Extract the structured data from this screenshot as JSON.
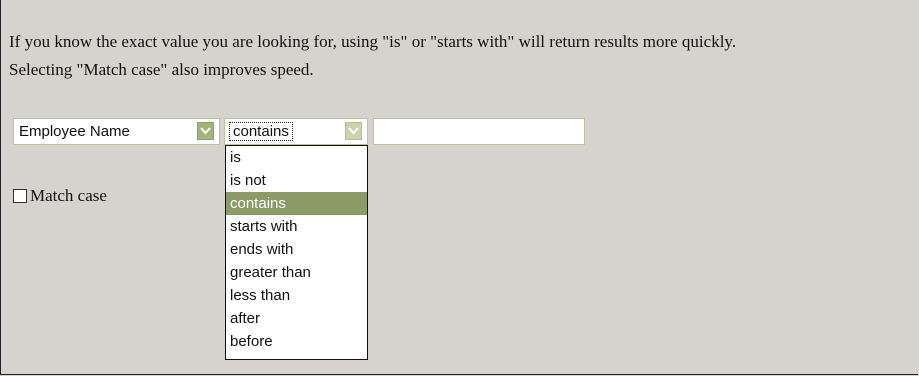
{
  "intro": {
    "line1": "If you know the exact value you are looking for, using \"is\" or \"starts with\" will return results more quickly.",
    "line2": "Selecting \"Match case\" also improves speed."
  },
  "filter": {
    "field_select": {
      "value": "Employee Name",
      "arrow_icon": "chevron-down-icon"
    },
    "operator_select": {
      "value": "contains",
      "arrow_icon": "chevron-down-icon",
      "options": [
        "is",
        "is not",
        "contains",
        "starts with",
        "ends with",
        "greater than",
        "less than",
        "after",
        "before"
      ],
      "selected_index": 2
    },
    "value_input": {
      "value": ""
    }
  },
  "match_case": {
    "label": "Match case",
    "checked": false
  },
  "colors": {
    "background": "#d6d3ce",
    "accent": "#a3b37c",
    "selected_option": "#8c9a67",
    "field_border": "#b9c59a"
  }
}
